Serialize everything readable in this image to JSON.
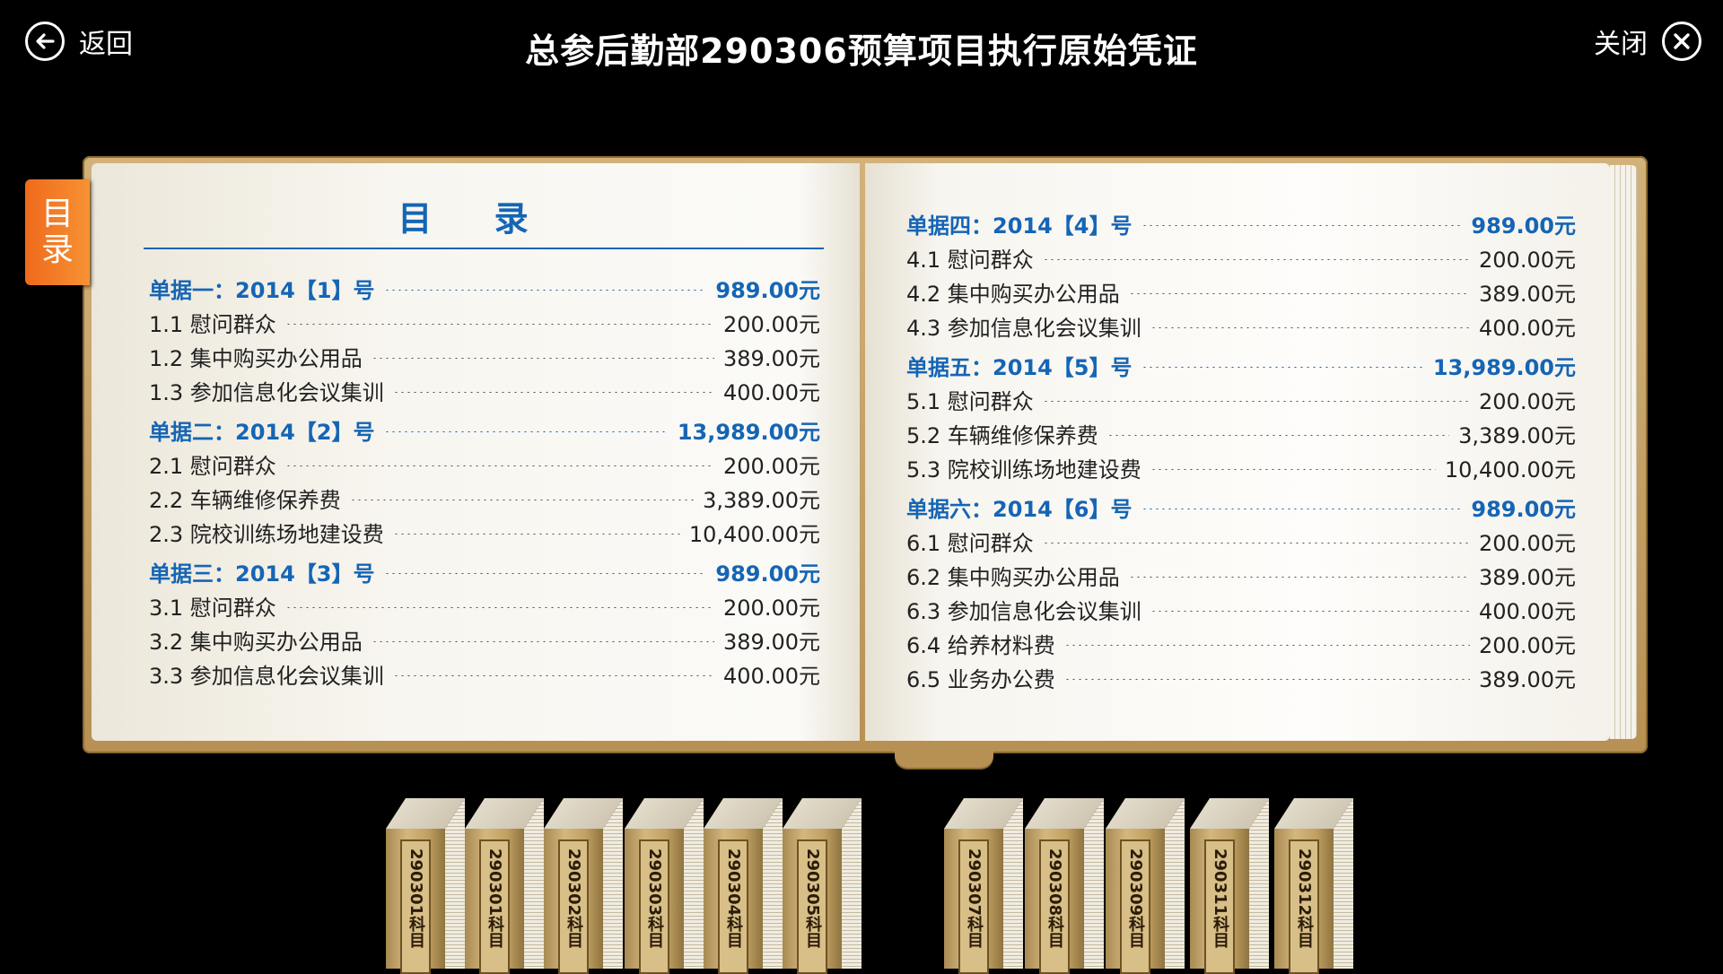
{
  "header": {
    "back_label": "返回",
    "title": "总参后勤部290306预算项目执行原始凭证",
    "close_label": "关闭"
  },
  "side_tab": {
    "label_top": "目",
    "label_bottom": "录"
  },
  "toc": {
    "title": "目 录",
    "left": [
      {
        "kind": "header",
        "label": "单据一：2014【1】号",
        "amount": "989.00元"
      },
      {
        "kind": "item",
        "label": "1.1 慰问群众",
        "amount": "200.00元"
      },
      {
        "kind": "item",
        "label": "1.2 集中购买办公用品",
        "amount": "389.00元"
      },
      {
        "kind": "item",
        "label": "1.3 参加信息化会议集训",
        "amount": "400.00元"
      },
      {
        "kind": "header",
        "label": "单据二：2014【2】号",
        "amount": "13,989.00元"
      },
      {
        "kind": "item",
        "label": "2.1 慰问群众",
        "amount": "200.00元"
      },
      {
        "kind": "item",
        "label": "2.2 车辆维修保养费",
        "amount": "3,389.00元"
      },
      {
        "kind": "item",
        "label": "2.3 院校训练场地建设费",
        "amount": "10,400.00元"
      },
      {
        "kind": "header",
        "label": "单据三：2014【3】号",
        "amount": "989.00元"
      },
      {
        "kind": "item",
        "label": "3.1 慰问群众",
        "amount": "200.00元"
      },
      {
        "kind": "item",
        "label": "3.2 集中购买办公用品",
        "amount": "389.00元"
      },
      {
        "kind": "item",
        "label": "3.3 参加信息化会议集训",
        "amount": "400.00元"
      }
    ],
    "right": [
      {
        "kind": "header",
        "label": "单据四：2014【4】号",
        "amount": "989.00元"
      },
      {
        "kind": "item",
        "label": "4.1 慰问群众",
        "amount": "200.00元"
      },
      {
        "kind": "item",
        "label": "4.2 集中购买办公用品",
        "amount": "389.00元"
      },
      {
        "kind": "item",
        "label": "4.3 参加信息化会议集训",
        "amount": "400.00元"
      },
      {
        "kind": "header",
        "label": "单据五：2014【5】号",
        "amount": "13,989.00元"
      },
      {
        "kind": "item",
        "label": "5.1 慰问群众",
        "amount": "200.00元"
      },
      {
        "kind": "item",
        "label": "5.2 车辆维修保养费",
        "amount": "3,389.00元"
      },
      {
        "kind": "item",
        "label": "5.3 院校训练场地建设费",
        "amount": "10,400.00元"
      },
      {
        "kind": "header",
        "label": "单据六：2014【6】号",
        "amount": "989.00元"
      },
      {
        "kind": "item",
        "label": "6.1 慰问群众",
        "amount": "200.00元"
      },
      {
        "kind": "item",
        "label": "6.2 集中购买办公用品",
        "amount": "389.00元"
      },
      {
        "kind": "item",
        "label": "6.3 参加信息化会议集训",
        "amount": "400.00元"
      },
      {
        "kind": "item",
        "label": "6.4 给养材料费",
        "amount": "200.00元"
      },
      {
        "kind": "item",
        "label": "6.5 业务办公费",
        "amount": "389.00元"
      }
    ]
  },
  "binders": [
    {
      "label": "290301科目"
    },
    {
      "label": "290301科目"
    },
    {
      "label": "290302科目"
    },
    {
      "label": "290303科目"
    },
    {
      "label": "290304科目"
    },
    {
      "label": "290305科目"
    },
    {
      "label": "290307科目"
    },
    {
      "label": "290308科目"
    },
    {
      "label": "290309科目"
    },
    {
      "label": "290311科目"
    },
    {
      "label": "290312科目"
    }
  ],
  "colors": {
    "accent_blue": "#1565b5",
    "tab_orange": "#f07a22",
    "background": "#000000"
  },
  "icons": {
    "back": "arrow-left-circle-icon",
    "close": "x-circle-icon"
  }
}
